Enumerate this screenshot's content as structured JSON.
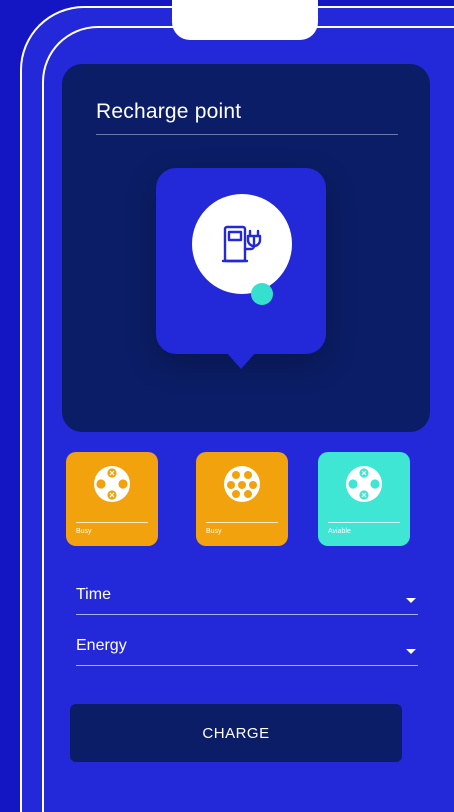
{
  "panel": {
    "title": "Recharge point"
  },
  "connectors": [
    {
      "label": "Busy",
      "color": "#f2a20d",
      "icon": "type2-plug-icon"
    },
    {
      "label": "Busy",
      "color": "#f2a20d",
      "icon": "ccs-plug-icon"
    },
    {
      "label": "Aviable",
      "color": "#3fe6d3",
      "icon": "type2-plug-icon"
    }
  ],
  "fields": {
    "time": "Time",
    "energy": "Energy"
  },
  "button": {
    "charge": "CHARGE"
  },
  "colors": {
    "background": "#1416c4",
    "screen": "#2328d8",
    "panel": "#0b1d66",
    "busy": "#f2a20d",
    "available": "#3fe6d3"
  },
  "icons": {
    "pin": "charging-station-icon",
    "status": "status-dot"
  }
}
